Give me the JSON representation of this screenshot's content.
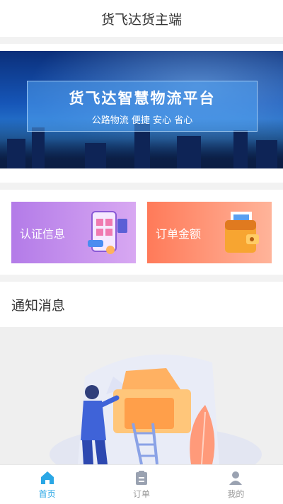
{
  "header": {
    "title": "货飞达货主端"
  },
  "banner": {
    "title": "货飞达智慧物流平台",
    "subtitle": "公路物流 便捷 安心 省心"
  },
  "cards": [
    {
      "label": "认证信息"
    },
    {
      "label": "订单金额"
    }
  ],
  "notice": {
    "title": "通知消息"
  },
  "tabbar": {
    "items": [
      {
        "label": "首页",
        "icon": "home-icon",
        "active": true
      },
      {
        "label": "订单",
        "icon": "order-icon",
        "active": false
      },
      {
        "label": "我的",
        "icon": "user-icon",
        "active": false
      }
    ],
    "active_color": "#2aa7e5",
    "inactive_color": "#999999"
  }
}
